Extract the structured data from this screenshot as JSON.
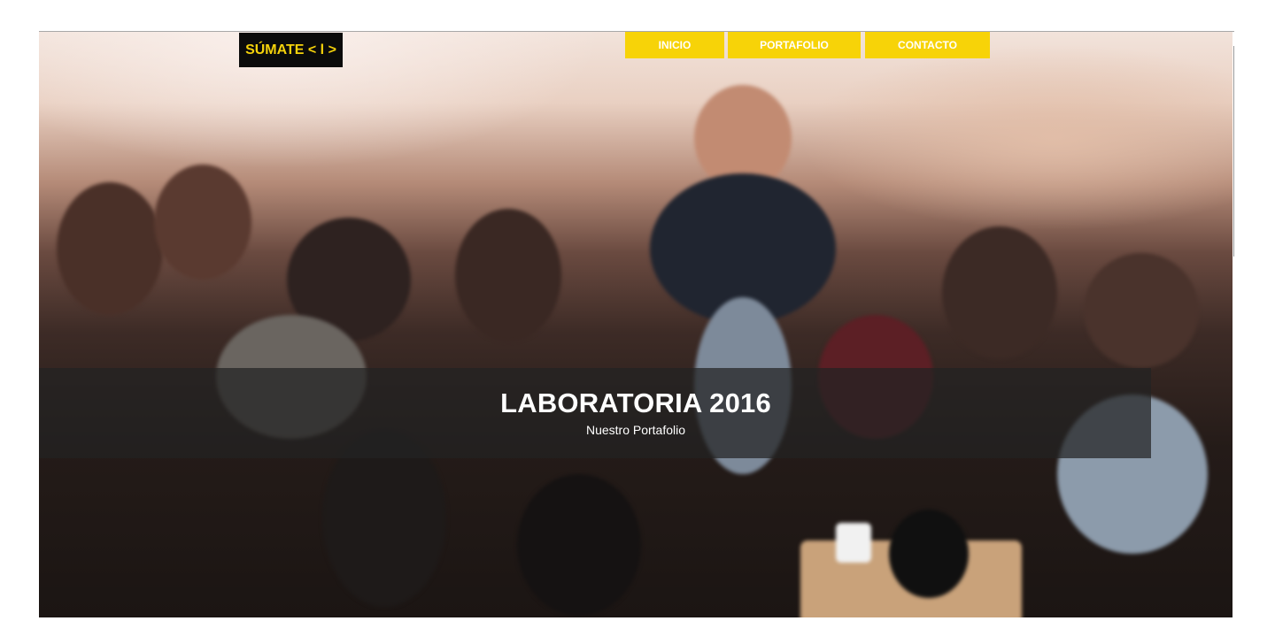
{
  "header": {
    "logo_text": "SÚMATE < l >",
    "nav": [
      {
        "label": "INICIO"
      },
      {
        "label": "PORTAFOLIO"
      },
      {
        "label": "CONTACTO"
      }
    ],
    "nav_color": "#f7d308",
    "logo_bg": "#0b0b0b",
    "logo_color": "#f5d20b"
  },
  "hero": {
    "image_icon": "group-photo",
    "title": "LABORATORIA 2016",
    "subtitle": "Nuestro Portafolio"
  }
}
